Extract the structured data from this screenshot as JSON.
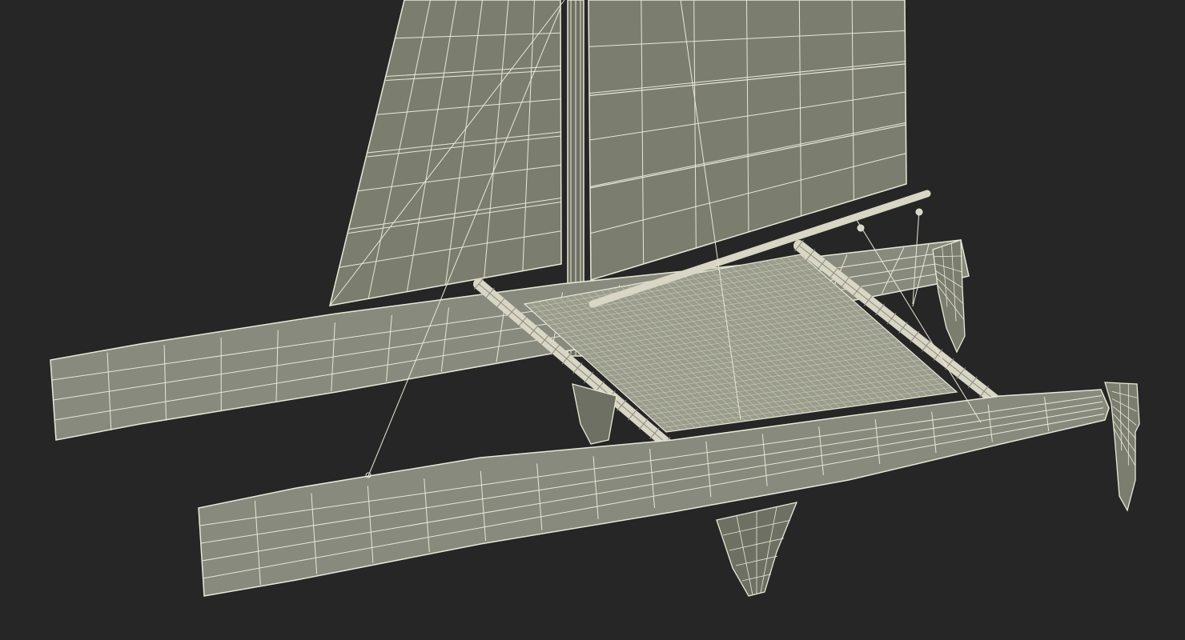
{
  "scene": {
    "subject": "catamaran-wireframe-render",
    "colors": {
      "background": "#262626",
      "surface": "#7b7d6f",
      "surface_dark": "#6e7063",
      "surface_light": "#878a7c",
      "wire": "#e9e8d8",
      "wire_dim": "#c9c8b6",
      "tube": "#d8d6c4"
    },
    "icons": [
      "main-sail",
      "jib-sail",
      "mast",
      "port-hull",
      "starboard-hull",
      "trampoline-net",
      "front-beam",
      "rear-beam",
      "boom",
      "daggerboard",
      "rudder"
    ]
  }
}
